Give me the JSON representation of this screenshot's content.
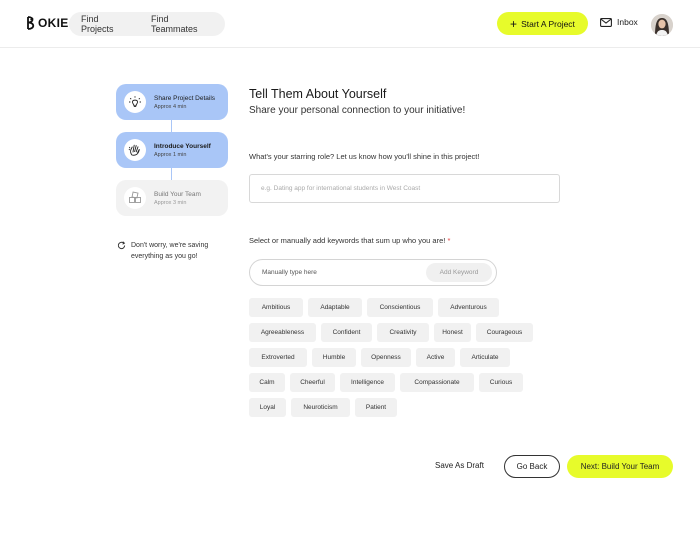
{
  "header": {
    "logo_text": "OKIE",
    "nav": [
      "Find Projects",
      "Find Teammates"
    ],
    "start_button": "Start A Project",
    "inbox_label": "Inbox",
    "accent_color": "#e7fb2b"
  },
  "steps": [
    {
      "title": "Share Project Details",
      "time": "Approx 4 min",
      "state": "completed",
      "icon": "lightbulb-icon"
    },
    {
      "title": "Introduce Yourself",
      "time": "Approx 1 min",
      "state": "active",
      "icon": "waving-hand-icon"
    },
    {
      "title": "Build Your Team",
      "time": "Approx 3 min",
      "state": "inactive",
      "icon": "blocks-icon"
    }
  ],
  "saving_note": "Don't worry, we're saving everything as you go!",
  "main": {
    "title": "Tell Them About Yourself",
    "subtitle": "Share your personal connection to your initiative!",
    "role_question": "What's your starring role? Let us know how you'll shine in this project!",
    "role_placeholder": "e.g. Dating app for international students in West Coast",
    "keywords_label": "Select or manually add keywords that sum up who you are!",
    "required_mark": "*",
    "keyword_placeholder": "Manually type here",
    "add_keyword_label": "Add Keyword",
    "keyword_rows": [
      [
        "Ambitious",
        "Adaptable",
        "Conscientious",
        "Adventurous"
      ],
      [
        "Agreeableness",
        "Confident",
        "Creativity",
        "Honest",
        "Courageous"
      ],
      [
        "Extroverted",
        "Humble",
        "Openness",
        "Active",
        "Articulate"
      ],
      [
        "Calm",
        "Cheerful",
        "Intelligence",
        "Compassionate",
        "Curious"
      ],
      [
        "Loyal",
        "Neuroticism",
        "Patient"
      ]
    ]
  },
  "actions": {
    "draft": "Save As Draft",
    "back": "Go Back",
    "next": "Next: Build Your Team"
  }
}
